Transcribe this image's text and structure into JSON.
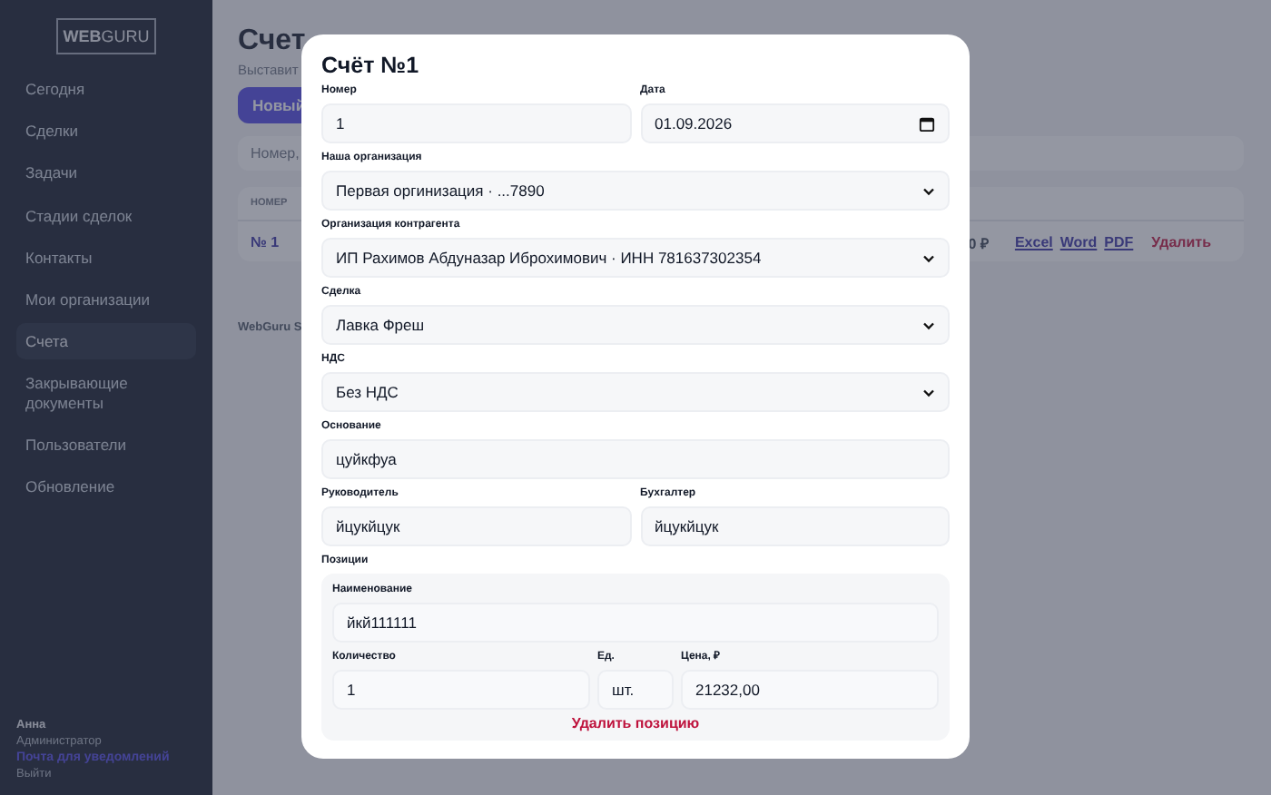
{
  "sidebar": {
    "logo": {
      "bold": "WEB",
      "light": "GURU"
    },
    "items": [
      {
        "label": "Сегодня",
        "selected": false
      },
      {
        "label": "Сделки",
        "selected": false
      },
      {
        "label": "Задачи",
        "selected": false
      },
      {
        "label": "Стадии сделок",
        "selected": false
      },
      {
        "label": "Контакты",
        "selected": false
      },
      {
        "label": "Мои организации",
        "selected": false
      },
      {
        "label": "Счета",
        "selected": true
      },
      {
        "label": "Закрывающие документы",
        "selected": false
      },
      {
        "label": "Пользователи",
        "selected": false
      },
      {
        "label": "Обновление",
        "selected": false
      }
    ],
    "user": {
      "name": "Анна",
      "role": "Администратор",
      "notify_link": "Почта для уведомлений",
      "logout": "Выйти"
    }
  },
  "page": {
    "title": "Счет",
    "subtitle": "Выставит",
    "new_button": "Новый",
    "search_placeholder": "Номер,",
    "table": {
      "columns": [
        "НОМЕР"
      ],
      "rows": [
        {
          "number": "№ 1",
          "amount": "0 ₽",
          "exports": [
            "Excel",
            "Word",
            "PDF"
          ],
          "delete": "Удалить"
        }
      ]
    },
    "footer": "WebGuru S"
  },
  "modal": {
    "title": "Счёт №1",
    "rows": [
      [
        {
          "kind": "text",
          "label": "Номер",
          "value": "1"
        },
        {
          "kind": "date",
          "label": "Дата",
          "value": "01.09.2026"
        }
      ],
      [
        {
          "kind": "select",
          "label": "Наша организация",
          "value": "Первая оргинизация · ...7890"
        }
      ],
      [
        {
          "kind": "select",
          "label": "Организация контрагента",
          "value": "ИП Рахимов Абдуназар Иброхимович · ИНН 781637302354"
        }
      ],
      [
        {
          "kind": "select",
          "label": "Сделка",
          "value": "Лавка Фреш"
        }
      ],
      [
        {
          "kind": "select",
          "label": "НДС",
          "value": "Без НДС"
        }
      ],
      [
        {
          "kind": "text",
          "label": "Основание",
          "value": "цуйкфуа"
        }
      ],
      [
        {
          "kind": "text",
          "label": "Руководитель",
          "value": "йцукйцук"
        },
        {
          "kind": "text",
          "label": "Бухгалтер",
          "value": "йцукйцук"
        }
      ]
    ],
    "positions": {
      "label": "Позиции",
      "items": [
        {
          "name_label": "Наименование",
          "name": "йкй111111",
          "qty_label": "Количество",
          "qty": "1",
          "unit_label": "Ед.",
          "unit": "шт.",
          "price_label": "Цена, ₽",
          "price": "21232,00",
          "delete": "Удалить позицию"
        }
      ]
    }
  }
}
